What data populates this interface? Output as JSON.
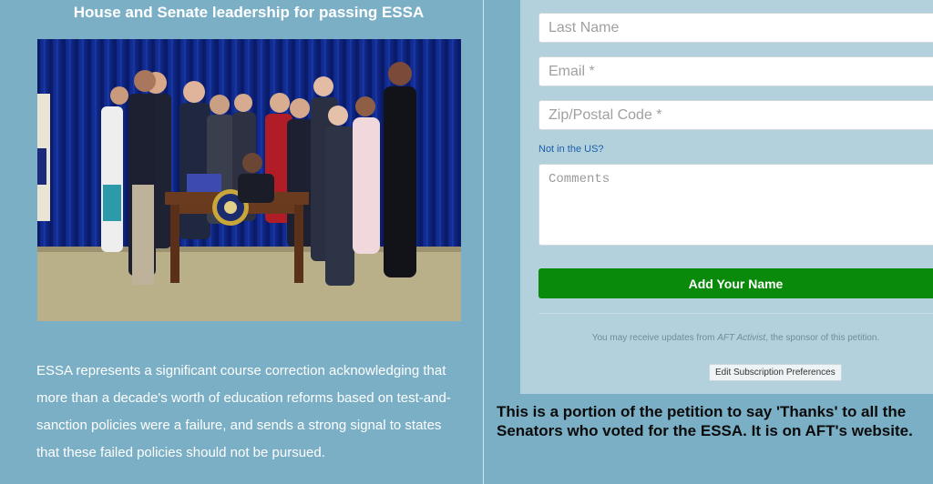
{
  "left": {
    "headline": "House and Senate leadership for passing ESSA",
    "body": "ESSA represents a significant course correction acknowledging that more than a decade's worth of education reforms based on test-and-sanction policies were a failure, and sends a strong signal to states that these failed policies should not be pursued."
  },
  "form": {
    "last_name_placeholder": "Last Name",
    "email_placeholder": "Email *",
    "zip_placeholder": "Zip/Postal Code *",
    "not_us_link": "Not in the US?",
    "comments_placeholder": "Comments",
    "submit_label": "Add Your Name",
    "sponsor_prefix": "You may receive updates from ",
    "sponsor_name": "AFT Activist",
    "sponsor_suffix": ", the sponsor of this petition.",
    "edit_subscription_label": "Edit Subscription Preferences"
  },
  "caption": "This is a portion of the petition to say 'Thanks' to all the Senators who voted for the ESSA. It is on AFT's website.",
  "colors": {
    "background": "#7aafc5",
    "form_card": "#b2d1dd",
    "submit_button": "#0a8a0a",
    "link": "#1a5fa8"
  }
}
